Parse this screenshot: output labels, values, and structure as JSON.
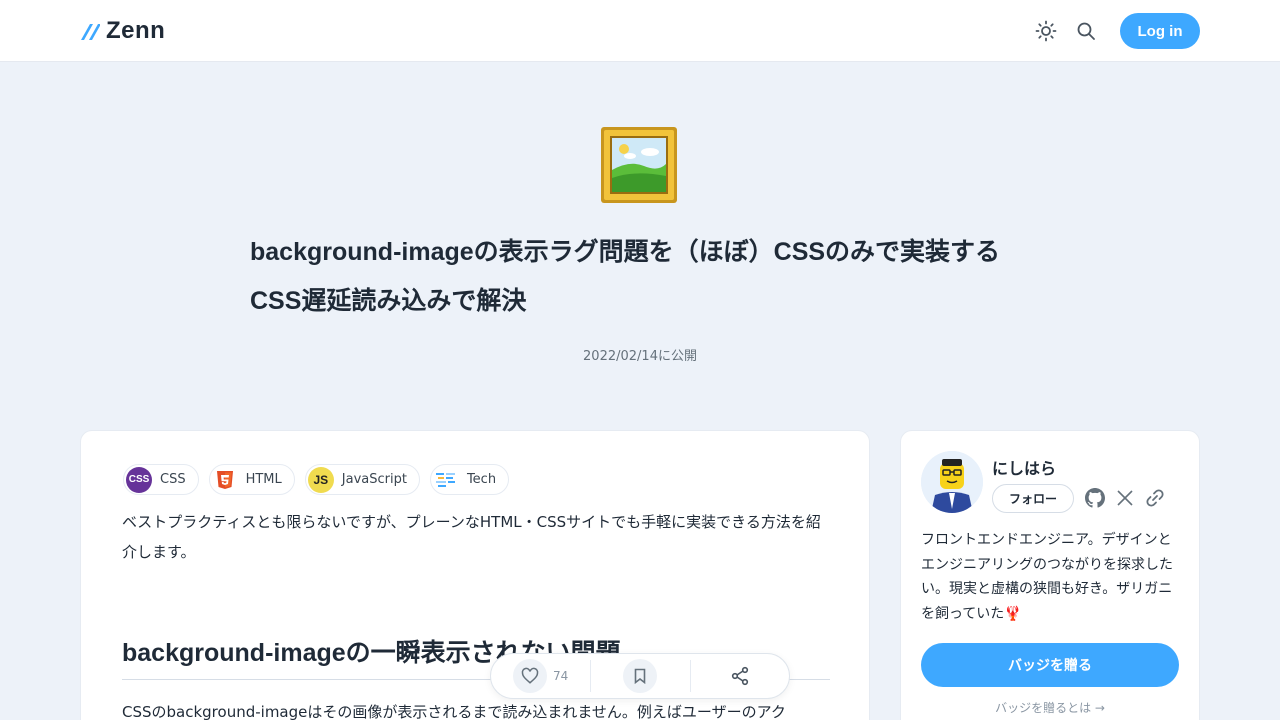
{
  "header": {
    "logo_text": "Zenn",
    "login_label": "Log in",
    "icons": [
      "theme-toggle-icon",
      "search-icon"
    ]
  },
  "article": {
    "emoji": "framed-picture",
    "title": "background-imageの表示ラグ問題を（ほぼ）CSSのみで実装するCSS遅延読み込みで解決",
    "published": "2022/02/14に公開",
    "topics": [
      {
        "label": "CSS",
        "icon": "css-icon"
      },
      {
        "label": "HTML",
        "icon": "html5-icon"
      },
      {
        "label": "JavaScript",
        "icon": "javascript-icon"
      },
      {
        "label": "Tech",
        "icon": "tech-icon"
      }
    ],
    "lead": "ベストプラクティスとも限らないですが、プレーンなHTML・CSSサイトでも手軽に実装できる方法を紹介します。",
    "heading": "background-imageの一瞬表示されない問題",
    "body_start": "CSSのbackground-imageはその画像が表示されるまで読み込まれません。例えばユーザーのアク"
  },
  "actions": {
    "like_count": "74"
  },
  "author": {
    "name": "にしはら",
    "follow_label": "フォロー",
    "bio": "フロントエンドエンジニア。デザインとエンジニアリングのつながりを探求したい。現実と虚構の狭間も好き。ザリガニを飼っていた🦞",
    "badge_label": "バッジを贈る",
    "badge_link": "バッジを贈るとは →"
  },
  "colors": {
    "accent": "#3ea8ff",
    "background": "#edf2f9",
    "text": "#1f2a37"
  }
}
